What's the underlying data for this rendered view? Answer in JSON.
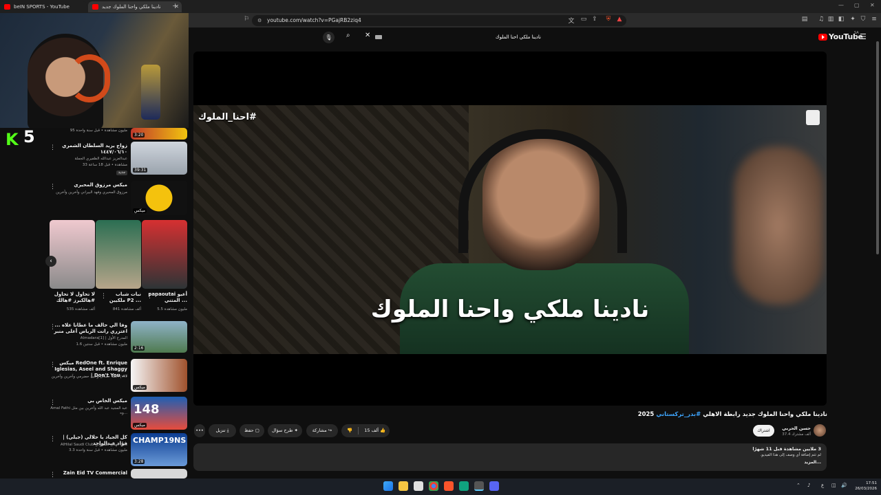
{
  "browser": {
    "tabs": [
      {
        "label": "beIN SPORTS - YouTube"
      },
      {
        "label": "نادينا ملكي واحنا الملوك جديد"
      }
    ],
    "new_tab": "+",
    "url": "youtube.com/watch?v=PGajRB2ziq4"
  },
  "stream": {
    "kick_logo": "K",
    "viewer_count": "5"
  },
  "youtube": {
    "logo": "YouTube",
    "region": "SA",
    "search_value": "نادينا ملكي احنا الملوك"
  },
  "sidebar": {
    "partial_top": {
      "meta": "95 مليون مشاهدة • قبل سنة واحدة",
      "duration": "3:20"
    },
    "recs": [
      {
        "title": "زواج يزيد السلطان الشمري ١٤٤٧/٠٦/١٠",
        "channel": "عبدالعزيز عبدالله الظفيري الجملة",
        "stats": "33 مشاهدة • قبل 18 ساعة",
        "duration": "39:31",
        "badge": "جديد"
      },
      {
        "title": "ميكس مرزوق المحيري",
        "channel": "مرزوق المحيري وفهد البيراني وآخرين وآخرين",
        "stats": "",
        "duration": "ميكس"
      },
      {
        "title": "وفا الي حالف ما عطانا علاه ... اعتزري رانت الرياض أعلى منبر",
        "channel": "Almadara[1] | المدرج الأول",
        "stats": "1.6 مليون مشاهدة • قبل سنتين",
        "duration": "2:16"
      },
      {
        "title": "ميكس RedOne ft. Enrique Iglesias, Aseel and Shaggy | Don't You ...",
        "channel": "أحمد حمدان وعبيد حضرمي وآخرين وآخرين | AT",
        "stats": "",
        "duration": "ميكس"
      },
      {
        "title": "ميكس الخاص بي",
        "channel": "Amal Fathi عبد المجيد عبد الله وآخرين بين مثل وه...",
        "stats": "",
        "duration": "ميكس",
        "thumb_number": "148"
      },
      {
        "title": "كل الجياد يا حلالي (جيلي) | فؤاد عبدالواحد",
        "channel": "AlHilal Saudi Club نادي الهلال السعودي",
        "stats": "3.3 مليون مشاهدة • قبل سنة واحدة",
        "duration": "3:28",
        "thumb_text": "CHAMP19NS"
      },
      {
        "title": "Zain Eid TV Commercial",
        "channel": "",
        "stats": "",
        "duration": ""
      }
    ],
    "shorts": [
      {
        "title": "papaoutai أعيو المتني ...",
        "views": "5.5 مليون مشاهدة"
      },
      {
        "title": "نبات شباب ملكيين P2 ...",
        "views": "841 ألف مشاهدة"
      },
      {
        "title": "لا تحاول لا تحاول #هالكبرز #هالك",
        "views": "535 ألف مشاهدة"
      }
    ],
    "shorts_prev": "‹"
  },
  "player": {
    "hashtag": "#احنا_الملوك",
    "caption": "نادينا ملكي واحنا الملوك"
  },
  "video": {
    "title": "نادينا ملكي واحنا الملوك جديد رابطة الاهلي",
    "title_tag": "#بدر_تركستاني",
    "title_year": "2025",
    "channel_name": "حسن الحربي",
    "subscribers": "37.4 ألف مشترك",
    "subscribe_label": "اشتراك",
    "likes": "15 ألف",
    "share_label": "مشاركة",
    "ask_label": "طرح سؤال",
    "save_label": "حفظ",
    "download_label": "تنزيل",
    "more_label": "•••",
    "views_line": "3 ملايين مشاهدة  قبل 11 شهرًا",
    "desc_line": "لم تتم إضافة أي وصف إلى هذا الفيديو.",
    "desc_more": "...المزيد"
  },
  "taskbar": {
    "clock_time": "17:51",
    "clock_date": "26/03/2026",
    "lang": "ع"
  }
}
